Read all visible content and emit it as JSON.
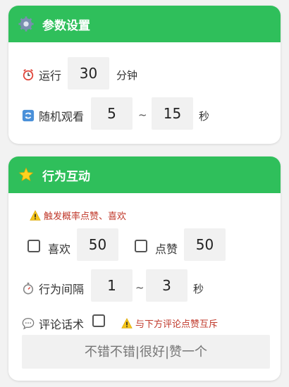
{
  "params_card": {
    "title": "参数设置",
    "header_icon": "gear-icon",
    "run": {
      "icon": "alarm-clock-icon",
      "label": "运行",
      "value": "30",
      "unit": "分钟"
    },
    "random_watch": {
      "icon": "refresh-icon",
      "label": "随机观看",
      "min": "5",
      "tilde": "~",
      "max": "15",
      "unit": "秒"
    }
  },
  "behavior_card": {
    "title": "行为互动",
    "header_icon": "star-icon",
    "warning": {
      "icon": "warning-icon",
      "text": "触发概率点赞、喜欢"
    },
    "like": {
      "label": "喜欢",
      "value": "50"
    },
    "thumbs_up": {
      "label": "点赞",
      "value": "50"
    },
    "interval": {
      "icon": "stopwatch-icon",
      "label": "行为间隔",
      "min": "1",
      "tilde": "~",
      "max": "3",
      "unit": "秒"
    },
    "comment": {
      "icon": "speech-bubble-icon",
      "label": "评论话术",
      "warning": "与下方评论点赞互斥",
      "placeholder": "不错不错|很好|赞一个"
    }
  },
  "colors": {
    "header_green": "#2fbf5b",
    "warning_red": "#c0392b",
    "input_bg": "#f1f1f1"
  }
}
